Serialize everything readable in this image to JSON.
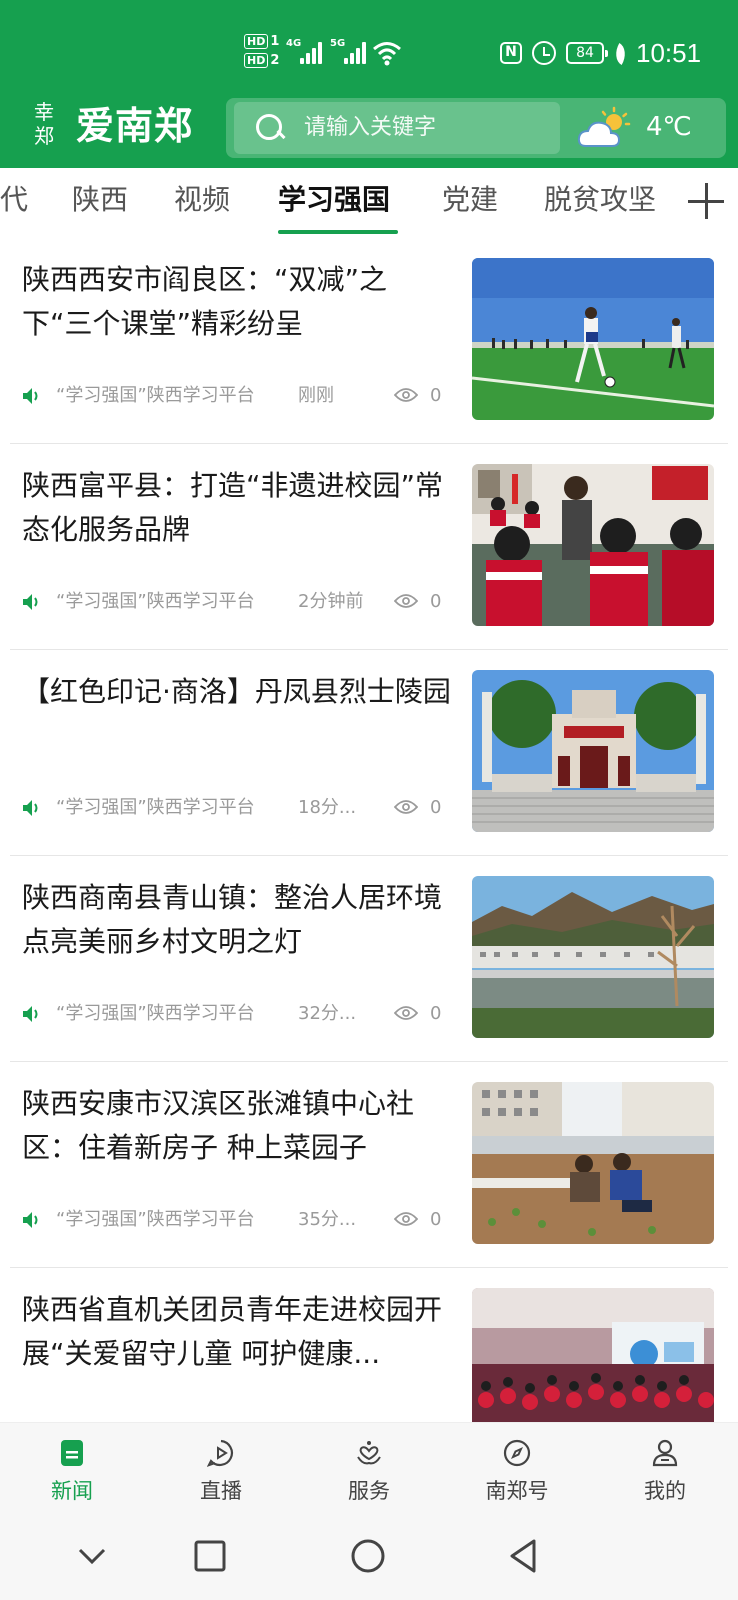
{
  "status_bar": {
    "hd1": "HD",
    "hd1_num": "1",
    "hd2": "HD",
    "hd2_num": "2",
    "net1": "4G",
    "net2": "5G",
    "nfc": "N",
    "battery": "84",
    "time": "10:51"
  },
  "app_bar": {
    "logo_mark": "幸\n郑",
    "logo_text": "爱南郑",
    "search_placeholder": "请输入关键字",
    "weather_icon": "partly-cloudy-icon",
    "temperature": "4℃"
  },
  "tabs": {
    "items": [
      {
        "label": "代"
      },
      {
        "label": "陕西"
      },
      {
        "label": "视频"
      },
      {
        "label": "学习强国",
        "active": true
      },
      {
        "label": "党建"
      },
      {
        "label": "脱贫攻坚"
      }
    ],
    "add_icon": "plus-icon"
  },
  "news": [
    {
      "title": "陕西西安市阎良区：“双减”之下“三个课堂”精彩纷呈",
      "source": "“学习强国”陕西学习平台",
      "time": "刚刚",
      "views": "0",
      "image": "kids-playing-football-photo"
    },
    {
      "title": "陕西富平县：打造“非遗进校园”常态化服务品牌",
      "source": "“学习强国”陕西学习平台",
      "time": "2分钟前",
      "views": "0",
      "image": "classroom-students-photo"
    },
    {
      "title": "【红色印记·商洛】丹凤县烈士陵园",
      "source": "“学习强国”陕西学习平台",
      "time": "18分...",
      "views": "0",
      "image": "martyrs-cemetery-gate-photo"
    },
    {
      "title": "陕西商南县青山镇：整治人居环境 点亮美丽乡村文明之灯",
      "source": "“学习强国”陕西学习平台",
      "time": "32分...",
      "views": "0",
      "image": "mountain-village-river-photo"
    },
    {
      "title": "陕西安康市汉滨区张滩镇中心社区：住着新房子 种上菜园子",
      "source": "“学习强国”陕西学习平台",
      "time": "35分...",
      "views": "0",
      "image": "villagers-planting-vegetables-photo"
    },
    {
      "title": "陕西省直机关团员青年走进校园开展“关爱留守儿童 呵护健康...",
      "source": "",
      "time": "",
      "views": "",
      "image": "students-in-auditorium-photo"
    }
  ],
  "bottom_nav": [
    {
      "label": "新闻",
      "icon": "news-icon",
      "active": true
    },
    {
      "label": "直播",
      "icon": "live-icon"
    },
    {
      "label": "服务",
      "icon": "service-icon"
    },
    {
      "label": "南郑号",
      "icon": "compass-icon"
    },
    {
      "label": "我的",
      "icon": "profile-icon"
    }
  ],
  "system_nav": [
    "collapse-icon",
    "recents-icon",
    "home-icon",
    "back-icon"
  ],
  "colors": {
    "brand_green": "#16a04f",
    "text_primary": "#1a1a1a",
    "text_meta": "#9a9a9a"
  }
}
